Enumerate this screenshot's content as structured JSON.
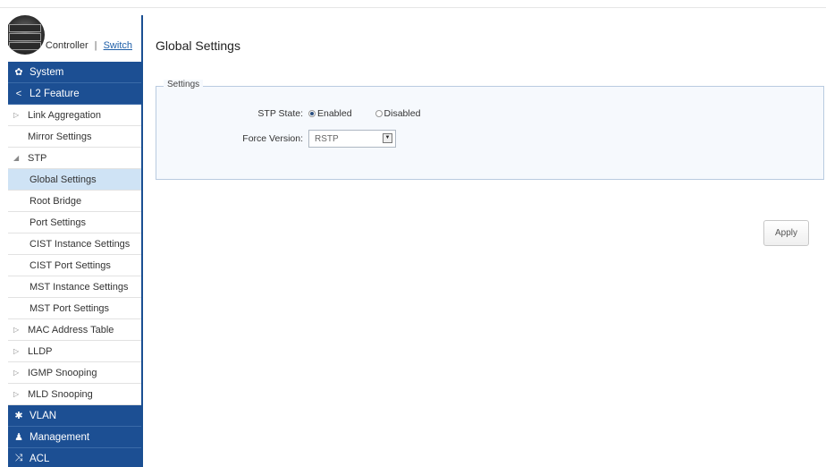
{
  "brand": {
    "controller_label": "Controller",
    "separator": "|",
    "switch_label": "Switch"
  },
  "sidebar": {
    "header_system": {
      "label": "System",
      "icon": "gear-icon"
    },
    "header_l2": {
      "label": "L2 Feature",
      "icon": "share-icon"
    },
    "items": {
      "link_aggregation": "Link Aggregation",
      "mirror_settings": "Mirror Settings",
      "stp": "STP",
      "global_settings": "Global Settings",
      "root_bridge": "Root Bridge",
      "port_settings": "Port Settings",
      "cist_instance": "CIST Instance Settings",
      "cist_port": "CIST Port Settings",
      "mst_instance": "MST Instance Settings",
      "mst_port": "MST Port Settings",
      "mac_address_table": "MAC Address Table",
      "lldp": "LLDP",
      "igmp_snooping": "IGMP Snooping",
      "mld_snooping": "MLD Snooping"
    },
    "header_vlan": {
      "label": "VLAN",
      "icon": "network-icon"
    },
    "header_management": {
      "label": "Management",
      "icon": "user-icon"
    },
    "header_acl": {
      "label": "ACL",
      "icon": "shuffle-icon"
    }
  },
  "main": {
    "title": "Global Settings",
    "fieldset_legend": "Settings",
    "stp_state_label": "STP State:",
    "stp_enabled": "Enabled",
    "stp_disabled": "Disabled",
    "stp_selected": "Enabled",
    "force_version_label": "Force Version:",
    "force_version_value": "RSTP",
    "apply_label": "Apply"
  }
}
